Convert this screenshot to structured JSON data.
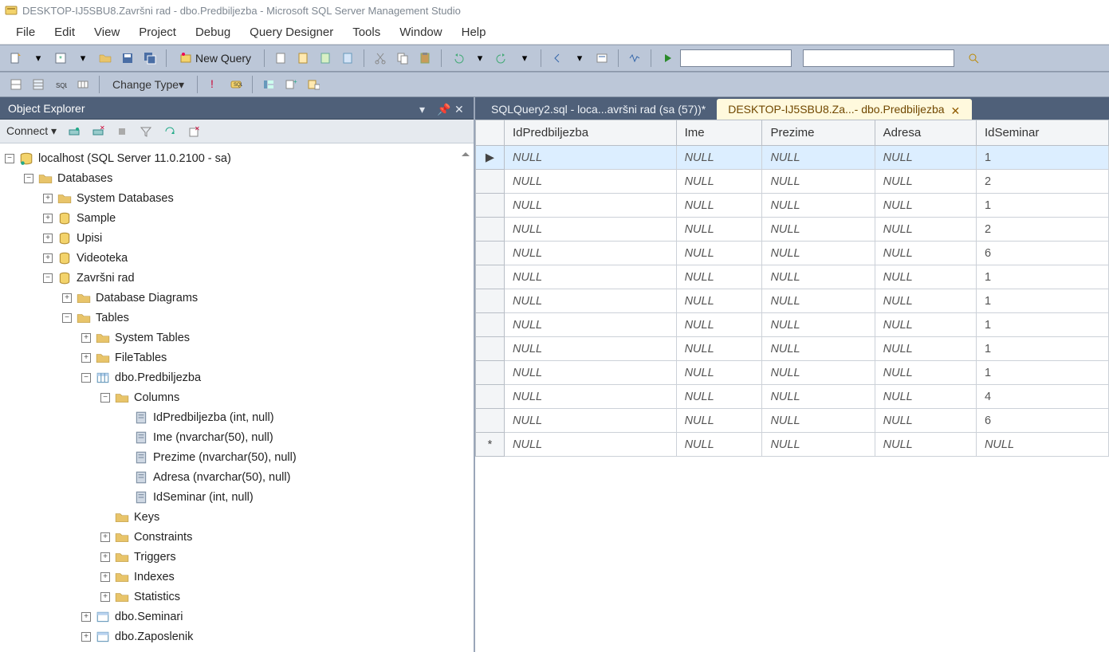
{
  "window": {
    "title": "DESKTOP-IJ5SBU8.Završni rad - dbo.Predbiljezba - Microsoft SQL Server Management Studio"
  },
  "menu": [
    "File",
    "Edit",
    "View",
    "Project",
    "Debug",
    "Query Designer",
    "Tools",
    "Window",
    "Help"
  ],
  "toolbar": {
    "new_query": "New Query",
    "change_type": "Change Type"
  },
  "object_explorer": {
    "title": "Object Explorer",
    "connect": "Connect",
    "tree": {
      "server": "localhost (SQL Server 11.0.2100 - sa)",
      "databases": "Databases",
      "system_databases": "System Databases",
      "db_sample": "Sample",
      "db_upisi": "Upisi",
      "db_videoteka": "Videoteka",
      "db_zavrsni": "Završni rad",
      "diagrams": "Database Diagrams",
      "tables": "Tables",
      "system_tables": "System Tables",
      "file_tables": "FileTables",
      "tbl_predbiljezba": "dbo.Predbiljezba",
      "columns": "Columns",
      "col1": "IdPredbiljezba (int, null)",
      "col2": "Ime (nvarchar(50), null)",
      "col3": "Prezime (nvarchar(50), null)",
      "col4": "Adresa (nvarchar(50), null)",
      "col5": "IdSeminar (int, null)",
      "keys": "Keys",
      "constraints": "Constraints",
      "triggers": "Triggers",
      "indexes": "Indexes",
      "statistics": "Statistics",
      "tbl_seminari": "dbo.Seminari",
      "tbl_zaposlenik": "dbo.Zaposlenik"
    }
  },
  "tabs": [
    {
      "label": "SQLQuery2.sql - loca...avršni rad (sa (57))*",
      "active": false
    },
    {
      "label": "DESKTOP-IJ5SBU8.Za...- dbo.Predbiljezba",
      "active": true
    }
  ],
  "grid": {
    "columns": [
      "IdPredbiljezba",
      "Ime",
      "Prezime",
      "Adresa",
      "IdSeminar"
    ],
    "null": "NULL",
    "rows": [
      {
        "marker": "▶",
        "v": [
          "NULL",
          "NULL",
          "NULL",
          "NULL",
          "1"
        ],
        "selected": true
      },
      {
        "marker": "",
        "v": [
          "NULL",
          "NULL",
          "NULL",
          "NULL",
          "2"
        ]
      },
      {
        "marker": "",
        "v": [
          "NULL",
          "NULL",
          "NULL",
          "NULL",
          "1"
        ]
      },
      {
        "marker": "",
        "v": [
          "NULL",
          "NULL",
          "NULL",
          "NULL",
          "2"
        ]
      },
      {
        "marker": "",
        "v": [
          "NULL",
          "NULL",
          "NULL",
          "NULL",
          "6"
        ]
      },
      {
        "marker": "",
        "v": [
          "NULL",
          "NULL",
          "NULL",
          "NULL",
          "1"
        ]
      },
      {
        "marker": "",
        "v": [
          "NULL",
          "NULL",
          "NULL",
          "NULL",
          "1"
        ]
      },
      {
        "marker": "",
        "v": [
          "NULL",
          "NULL",
          "NULL",
          "NULL",
          "1"
        ]
      },
      {
        "marker": "",
        "v": [
          "NULL",
          "NULL",
          "NULL",
          "NULL",
          "1"
        ]
      },
      {
        "marker": "",
        "v": [
          "NULL",
          "NULL",
          "NULL",
          "NULL",
          "1"
        ]
      },
      {
        "marker": "",
        "v": [
          "NULL",
          "NULL",
          "NULL",
          "NULL",
          "4"
        ]
      },
      {
        "marker": "",
        "v": [
          "NULL",
          "NULL",
          "NULL",
          "NULL",
          "6"
        ]
      },
      {
        "marker": "*",
        "v": [
          "NULL",
          "NULL",
          "NULL",
          "NULL",
          "NULL"
        ]
      }
    ]
  }
}
